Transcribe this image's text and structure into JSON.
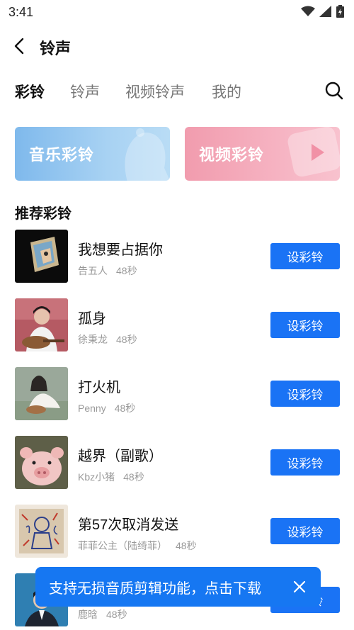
{
  "status": {
    "time": "3:41"
  },
  "header": {
    "title": "铃声"
  },
  "tabs": [
    {
      "label": "彩铃",
      "active": true
    },
    {
      "label": "铃声",
      "active": false
    },
    {
      "label": "视频铃声",
      "active": false
    },
    {
      "label": "我的",
      "active": false
    }
  ],
  "banners": {
    "music": "音乐彩铃",
    "video": "视频彩铃"
  },
  "section": {
    "title": "推荐彩铃"
  },
  "button_label": "设彩铃",
  "songs": [
    {
      "title": "我想要占据你",
      "artist": "告五人",
      "duration": "48秒"
    },
    {
      "title": "孤身",
      "artist": "徐秉龙",
      "duration": "48秒"
    },
    {
      "title": "打火机",
      "artist": "Penny",
      "duration": "48秒"
    },
    {
      "title": "越界（副歌）",
      "artist": "Kbz小猪",
      "duration": "48秒"
    },
    {
      "title": "第57次取消发送",
      "artist": "菲菲公主（陆绮菲）",
      "duration": "48秒"
    },
    {
      "title": "",
      "artist": "鹿晗",
      "duration": "48秒"
    }
  ],
  "toast": {
    "text": "支持无损音质剪辑功能，点击下载"
  },
  "colors": {
    "accent": "#1a73f5",
    "toast": "#1677f2"
  },
  "icons": [
    "back-arrow-icon",
    "search-icon",
    "close-icon",
    "wifi-icon",
    "signal-icon",
    "battery-icon",
    "bell-icon",
    "play-icon"
  ]
}
